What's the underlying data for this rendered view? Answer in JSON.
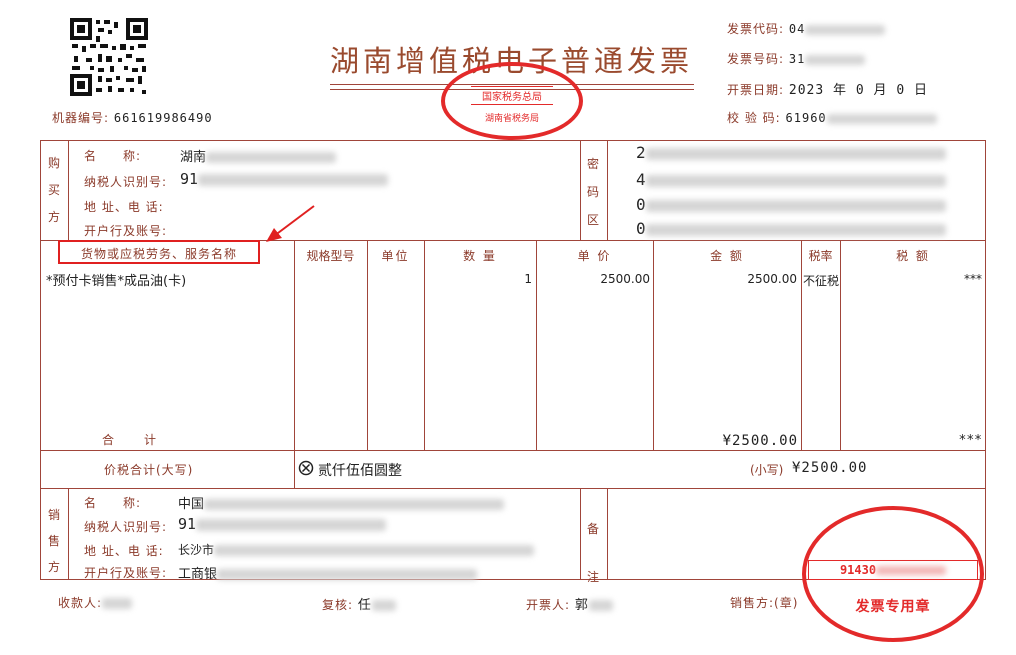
{
  "header": {
    "machine_no_label": "机器编号:",
    "machine_no": "661619986490",
    "title": "湖南增值税电子普通发票",
    "code_label": "发票代码:",
    "code_value": "04",
    "number_label": "发票号码:",
    "number_value": "31",
    "date_label": "开票日期:",
    "date_value": "2023 年 0 月 0 日",
    "check_label": "校 验 码:",
    "check_value": "61960"
  },
  "stamp_top": {
    "line1": "国家税务总局",
    "line2": "湖南省税务局"
  },
  "buyer": {
    "side_label": "购买方",
    "name_label": "名　　称:",
    "name_value": "湖南",
    "tax_label": "纳税人识别号:",
    "tax_value": "91",
    "addr_label": "地 址、电 话:",
    "bank_label": "开户行及账号:"
  },
  "password_area": {
    "label": "密码区",
    "rows": [
      "2",
      "4",
      "0",
      "0"
    ]
  },
  "items_header": {
    "name": "货物或应税劳务、服务名称",
    "spec": "规格型号",
    "unit": "单位",
    "qty": "数 量",
    "price": "单 价",
    "amount": "金 额",
    "rate": "税率",
    "tax": "税 额"
  },
  "items": [
    {
      "name": "*预付卡销售*成品油(卡)",
      "spec": "",
      "unit": "",
      "qty": "1",
      "price": "2500.00",
      "amount": "2500.00",
      "rate": "不征税",
      "tax": "***"
    }
  ],
  "totals": {
    "label": "合　　计",
    "amount": "¥2500.00",
    "tax": "***"
  },
  "grand_total": {
    "label": "价税合计(大写)",
    "upper_icon": "circle-x-icon",
    "upper": "贰仟伍佰圆整",
    "lower_label": "(小写)",
    "lower": "¥2500.00"
  },
  "seller": {
    "side_label": "销售方",
    "name_label": "名　　称:",
    "name_value": "中国",
    "tax_label": "纳税人识别号:",
    "tax_value": "91",
    "addr_label": "地 址、电 话:",
    "addr_value": "长沙市",
    "bank_label": "开户行及账号:",
    "bank_value": "工商银"
  },
  "remark": {
    "label": "备注"
  },
  "stamp_bottom": {
    "number": "91430",
    "label": "发票专用章"
  },
  "footer": {
    "payee_label": "收款人:",
    "reviewer_label": "复核:",
    "reviewer_value": "任",
    "drawer_label": "开票人:",
    "drawer_value": "郭",
    "seller_label": "销售方:(章)"
  },
  "colors": {
    "frame": "#a0453a",
    "stamp": "#e32a2a",
    "highlight": "#e02020"
  }
}
